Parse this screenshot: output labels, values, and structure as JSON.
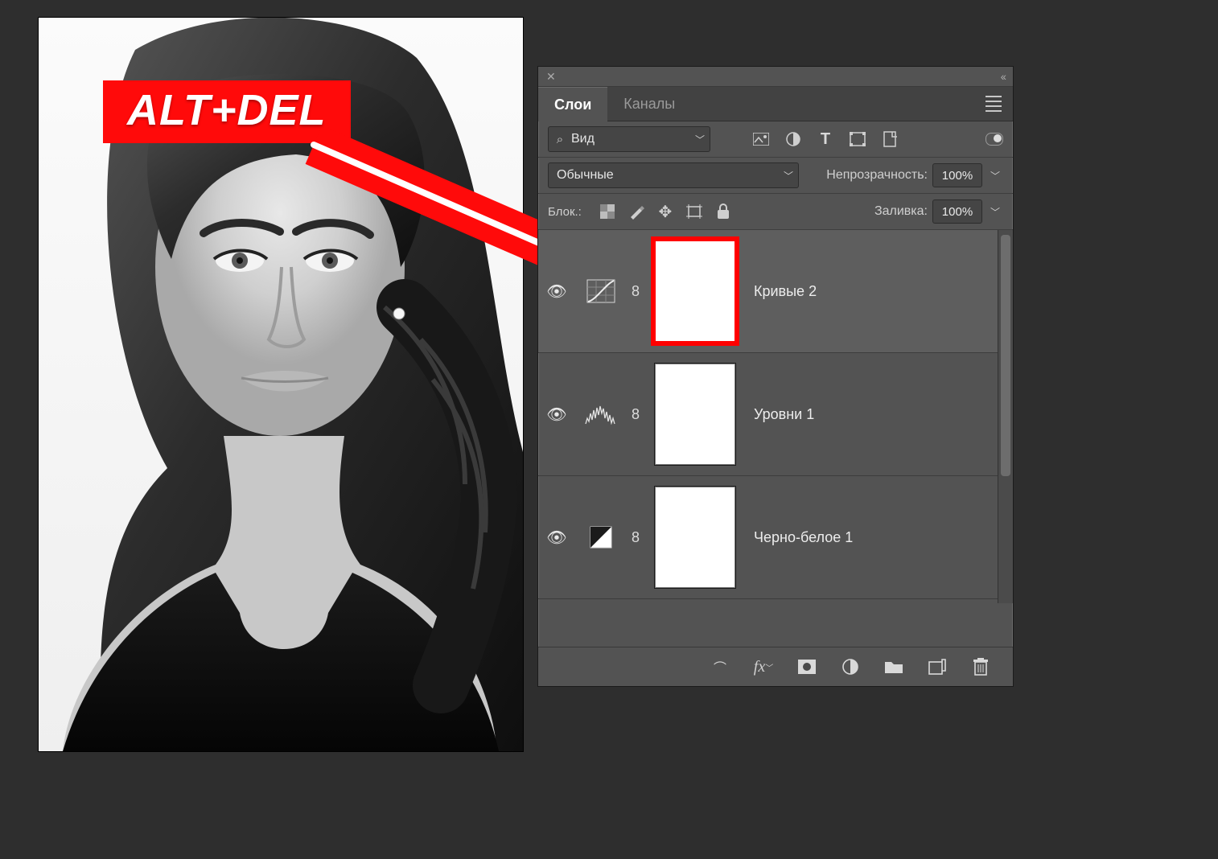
{
  "callout": {
    "text": "ALT+DEL"
  },
  "panel": {
    "tabs": {
      "layers": "Слои",
      "channels": "Каналы"
    },
    "filter_dropdown": "Вид",
    "blend_mode": "Обычные",
    "opacity_label": "Непрозрачность:",
    "opacity_value": "100%",
    "lock_label": "Блок.:",
    "fill_label": "Заливка:",
    "fill_value": "100%",
    "layers": [
      {
        "name": "Кривые 2",
        "type": "curves",
        "selected": true,
        "mask_highlight": true
      },
      {
        "name": "Уровни 1",
        "type": "levels",
        "selected": false,
        "mask_highlight": false
      },
      {
        "name": "Черно-белое 1",
        "type": "bw",
        "selected": false,
        "mask_highlight": false
      }
    ]
  },
  "colors": {
    "accent_red": "#ff0a0a"
  }
}
